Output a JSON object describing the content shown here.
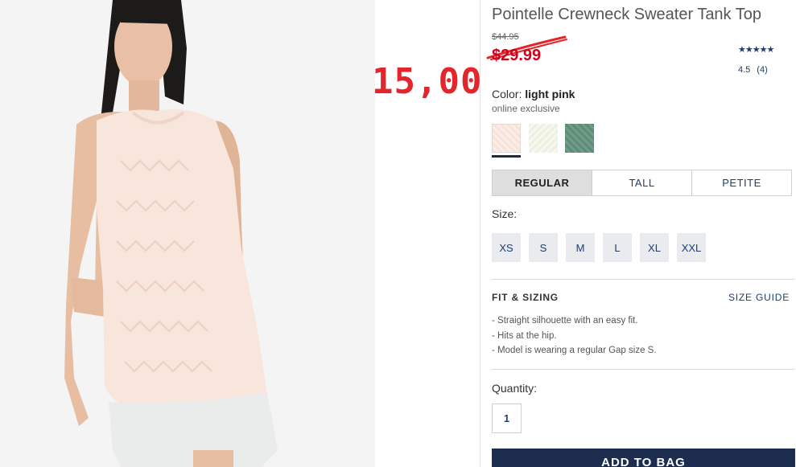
{
  "product": {
    "title": "Pointelle Crewneck Sweater Tank Top",
    "original_price": "$44.95",
    "sale_price": "$29.99",
    "stars": "★★★★★",
    "rating": "4.5",
    "review_count": "(4)",
    "color_label": "Color:",
    "color_value": "light pink",
    "color_note": "online exclusive",
    "swatches": [
      "light-pink-knit",
      "cream-knit",
      "green-knit"
    ],
    "selected_swatch": 0
  },
  "annotation": {
    "handwritten_price": "15,00",
    "color": "#e3262b"
  },
  "fits": {
    "options": [
      "REGULAR",
      "TALL",
      "PETITE"
    ],
    "selected": "REGULAR"
  },
  "sizes": {
    "label": "Size:",
    "options": [
      "XS",
      "S",
      "M",
      "L",
      "XL",
      "XXL"
    ]
  },
  "fit_sizing": {
    "heading": "FIT & SIZING",
    "guide_link": "SIZE GUIDE",
    "bullets": [
      "- Straight silhouette with an easy fit.",
      "- Hits at the hip.",
      "- Model is wearing a regular Gap size S."
    ]
  },
  "quantity": {
    "label": "Quantity:",
    "value": "1"
  },
  "cart": {
    "add_label": "ADD TO BAG"
  },
  "colors": {
    "accent": "#1f3e6d",
    "sale": "#d0021b",
    "button": "#1d2d4f"
  }
}
